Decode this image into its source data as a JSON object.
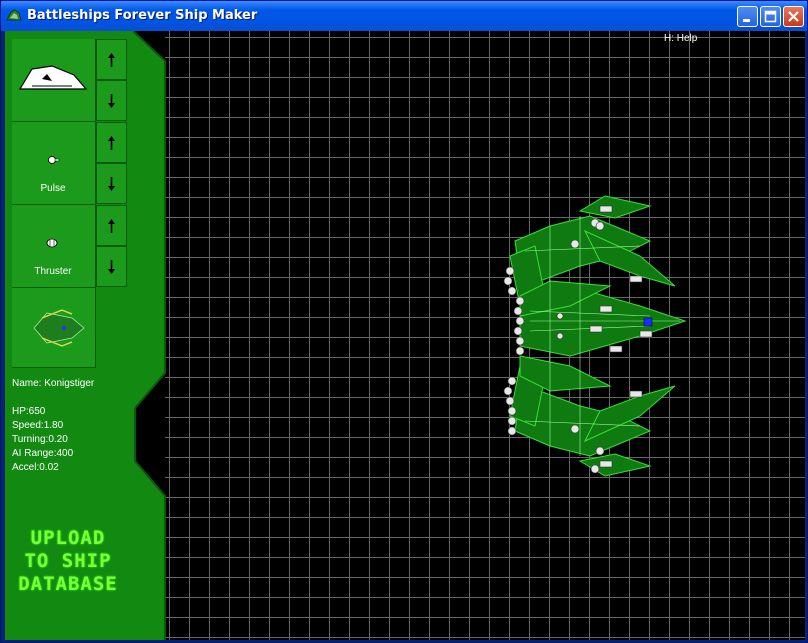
{
  "window": {
    "title": "Battleships Forever Ship Maker"
  },
  "help": {
    "text": "H: Help"
  },
  "parts": [
    {
      "label": "",
      "icon": "hull-section-icon"
    },
    {
      "label": "Pulse",
      "icon": "pulse-turret-icon"
    },
    {
      "label": "Thruster",
      "icon": "thruster-icon"
    },
    {
      "label": "",
      "icon": "ship-preview-icon"
    }
  ],
  "ship": {
    "name": "Name: Konigstiger",
    "hp": "HP:650",
    "speed": "Speed:1.80",
    "turning": "Turning:0.20",
    "ai_range": "AI Range:400",
    "accel": "Accel:0.02"
  },
  "upload": {
    "line1": "UPLOAD",
    "line2": "TO SHIP",
    "line3": "DATABASE"
  },
  "colors": {
    "panel": "#1c9a1c",
    "panel_dark": "#0c5a0c",
    "ship_outline": "#38e038",
    "grid": "#666666",
    "upload_text": "#7dff39"
  }
}
